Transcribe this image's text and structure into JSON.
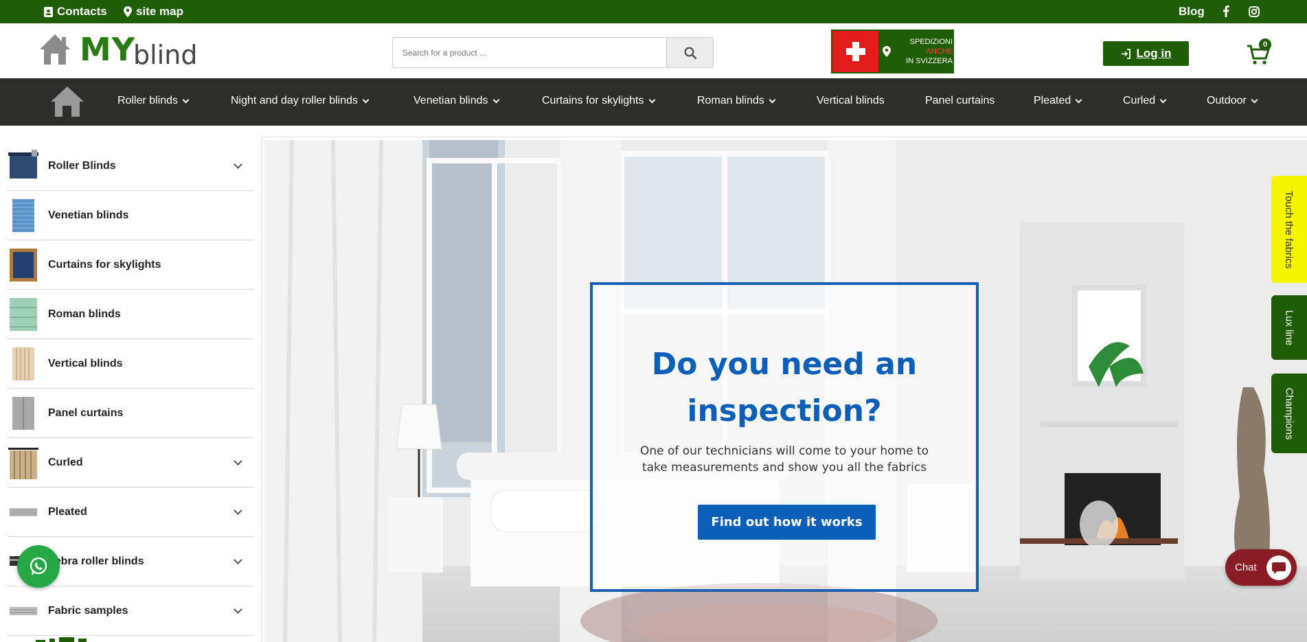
{
  "topbar": {
    "contacts": "Contacts",
    "sitemap": "site map",
    "blog": "Blog",
    "facebook_icon": "facebook-icon",
    "instagram_icon": "instagram-icon"
  },
  "header": {
    "logo_text": "blind",
    "logo_my": "MY",
    "search_placeholder": "Search for a product ...",
    "shipping_line1": "SPEDIZIONI",
    "shipping_line2": "ANCHE",
    "shipping_line3": "IN SVIZZERA",
    "login_label": "Log in",
    "cart_count": "0"
  },
  "nav": {
    "items": [
      {
        "label": "Roller blinds",
        "dropdown": true
      },
      {
        "label": "Night and day roller blinds",
        "dropdown": true
      },
      {
        "label": "Venetian blinds",
        "dropdown": true
      },
      {
        "label": "Curtains for skylights",
        "dropdown": true
      },
      {
        "label": "Roman blinds",
        "dropdown": true
      },
      {
        "label": "Vertical blinds",
        "dropdown": false
      },
      {
        "label": "Panel curtains",
        "dropdown": false
      },
      {
        "label": "Pleated",
        "dropdown": true
      },
      {
        "label": "Curled",
        "dropdown": true
      },
      {
        "label": "Outdoor",
        "dropdown": true
      }
    ]
  },
  "sidebar": {
    "items": [
      {
        "label": "Roller Blinds",
        "dropdown": true
      },
      {
        "label": "Venetian blinds",
        "dropdown": false
      },
      {
        "label": "Curtains for skylights",
        "dropdown": false
      },
      {
        "label": "Roman blinds",
        "dropdown": false
      },
      {
        "label": "Vertical blinds",
        "dropdown": false
      },
      {
        "label": "Panel curtains",
        "dropdown": false
      },
      {
        "label": "Curled",
        "dropdown": true
      },
      {
        "label": "Pleated",
        "dropdown": true
      },
      {
        "label": "Zebra roller blinds",
        "dropdown": true
      },
      {
        "label": "Fabric samples",
        "dropdown": true
      }
    ]
  },
  "hero": {
    "title": "Do you need an inspection?",
    "text": "One of our technicians will come to your home to take measurements and show you all the fabrics",
    "button": "Find out how it works"
  },
  "side_tabs": {
    "touch": "Touch the fabrics",
    "lux": "Lux line",
    "champions": "Champions"
  },
  "chat": {
    "label": "Chat"
  },
  "colors": {
    "brand_green": "#1f5e06",
    "nav_dark": "#2d2d2b",
    "cta_blue": "#0d5eb8",
    "chat_red": "#8a1c25",
    "tab_yellow": "#f5f500"
  }
}
